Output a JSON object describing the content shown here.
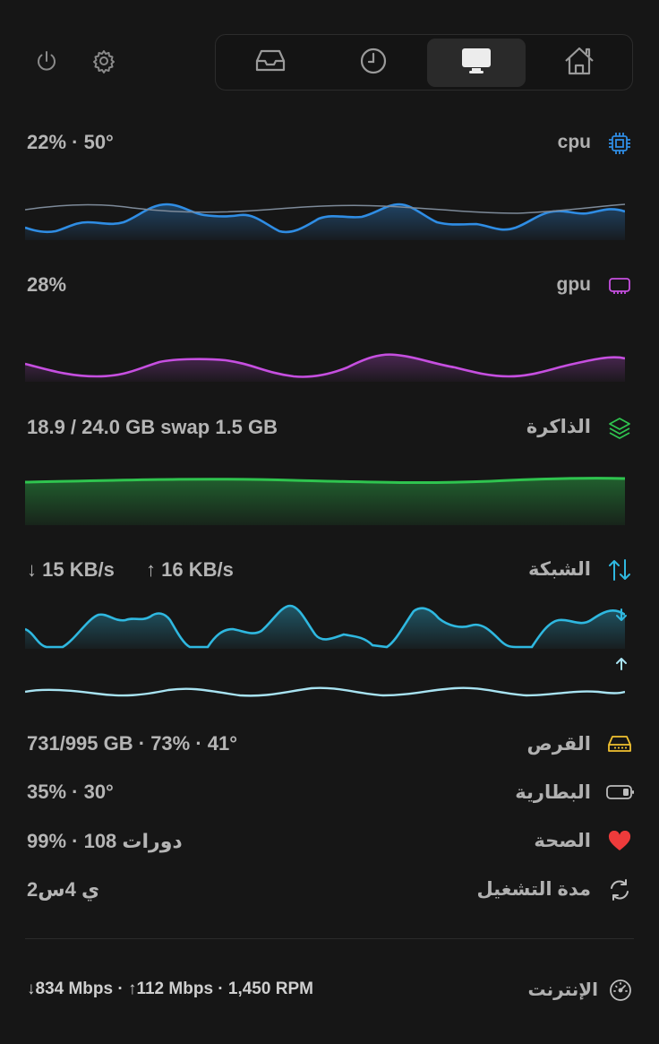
{
  "toolbar": {
    "power_icon": "power-icon",
    "settings_icon": "gear-icon"
  },
  "tabs": [
    {
      "name": "inbox",
      "icon": "tray-icon",
      "active": false
    },
    {
      "name": "history",
      "icon": "clock-icon",
      "active": false
    },
    {
      "name": "system",
      "icon": "monitor-icon",
      "active": true
    },
    {
      "name": "home",
      "icon": "house-icon",
      "active": false
    }
  ],
  "cpu": {
    "value": "22% · 50°",
    "label": "cpu",
    "color": "#2f8de4"
  },
  "gpu": {
    "value": "28%",
    "label": "gpu",
    "color": "#c64fe0"
  },
  "memory": {
    "value": "18.9 / 24.0 GB  swap 1.5 GB",
    "label": "الذاكرة",
    "color": "#2fc44f"
  },
  "network": {
    "down": "↓ 15 KB/s",
    "up": "↑ 16 KB/s",
    "label": "الشبكة",
    "color": "#2fb8e0",
    "up_color": "#a8e3f2"
  },
  "disk": {
    "value": "731/995 GB · 73% · 41°",
    "label": "القرص",
    "color": "#f2c230"
  },
  "battery": {
    "value": "35% · 30°",
    "label": "البطارية"
  },
  "health": {
    "value": "99% · 108 دورات",
    "label": "الصحة",
    "color": "#ee3b3b"
  },
  "uptime": {
    "value": "2ي 4س",
    "label": "مدة التشغيل"
  },
  "internet": {
    "value": "↓834 Mbps · ↑112 Mbps · 1,450 RPM",
    "label": "الإنترنت"
  }
}
